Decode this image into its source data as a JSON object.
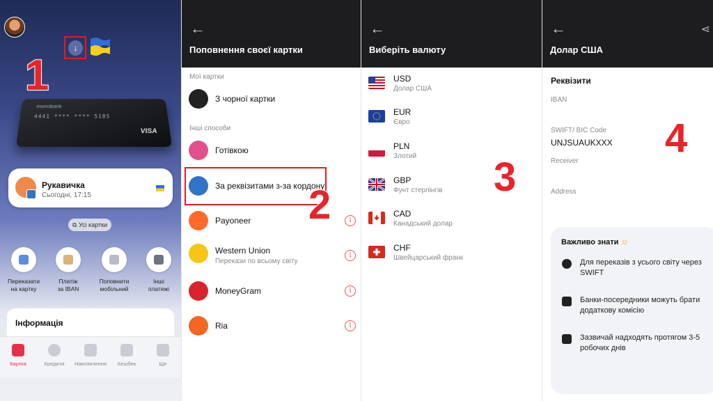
{
  "annotations": {
    "step1": "1",
    "step2": "2",
    "step3": "3",
    "step4": "4"
  },
  "panel1": {
    "card": {
      "brand": "monobank",
      "number": "4441 **** **** 5185",
      "network": "VISA"
    },
    "account": {
      "name": "Рукавичка",
      "time": "Сьогодні, 17:15"
    },
    "all_cards": "Усі картки",
    "actions": [
      {
        "label": "Переказати\nна картку",
        "icon": "card-icon",
        "color": "#5b8de0"
      },
      {
        "label": "Платіж\nза IBAN",
        "icon": "document-icon",
        "color": "#d8b37b"
      },
      {
        "label": "Поповнити\nмобільний",
        "icon": "phone-icon",
        "color": "#b9bcc6"
      },
      {
        "label": "Інші\nплатежі",
        "icon": "wallet-icon",
        "color": "#6f7380"
      }
    ],
    "info_title": "Інформація",
    "tabs": [
      {
        "label": "Картка",
        "active": true
      },
      {
        "label": "Кредити",
        "active": false
      },
      {
        "label": "Накопичення",
        "active": false
      },
      {
        "label": "Кешбек",
        "active": false
      },
      {
        "label": "Ще",
        "active": false
      }
    ]
  },
  "panel2": {
    "title": "Поповнення своєї картки",
    "section_my": "Мої картки",
    "black_card": "З чорної картки",
    "section_other": "Інші способи",
    "methods": [
      {
        "label": "Готівкою",
        "sub": "",
        "color": "#e0508c",
        "info": false
      },
      {
        "label": "За реквізитами з-за кордону",
        "sub": "",
        "color": "#2f74c6",
        "info": false
      },
      {
        "label": "Payoneer",
        "sub": "",
        "color": "#ff6a2b",
        "info": true
      },
      {
        "label": "Western Union",
        "sub": "Перекази по всьому світу",
        "color": "#f5c518",
        "info": true
      },
      {
        "label": "MoneyGram",
        "sub": "",
        "color": "#d8232a",
        "info": true
      },
      {
        "label": "Ria",
        "sub": "",
        "color": "#f26722",
        "info": true
      }
    ]
  },
  "panel3": {
    "title": "Виберіть валюту",
    "currencies": [
      {
        "code": "USD",
        "name": "Долар США"
      },
      {
        "code": "EUR",
        "name": "Євро"
      },
      {
        "code": "PLN",
        "name": "Злотий"
      },
      {
        "code": "GBP",
        "name": "Фунт стерлінгів"
      },
      {
        "code": "CAD",
        "name": "Канадський долар"
      },
      {
        "code": "CHF",
        "name": "Швейцарський франк"
      }
    ]
  },
  "panel4": {
    "title": "Долар США",
    "requisites": "Реквізити",
    "fields": [
      {
        "label": "IBAN",
        "value": ""
      },
      {
        "label": "SWIFT/ BIC Code",
        "value": "UNJSUAUKXXX"
      },
      {
        "label": "Receiver",
        "value": ""
      },
      {
        "label": "Address",
        "value": ""
      }
    ],
    "know_title": "Важливо знати",
    "know_items": [
      "Для переказів з усього світу через SWIFT",
      "Банки-посередники можуть брати додаткову комісію",
      "Зазвичай надходять протягом 3-5 робочих днів"
    ]
  }
}
